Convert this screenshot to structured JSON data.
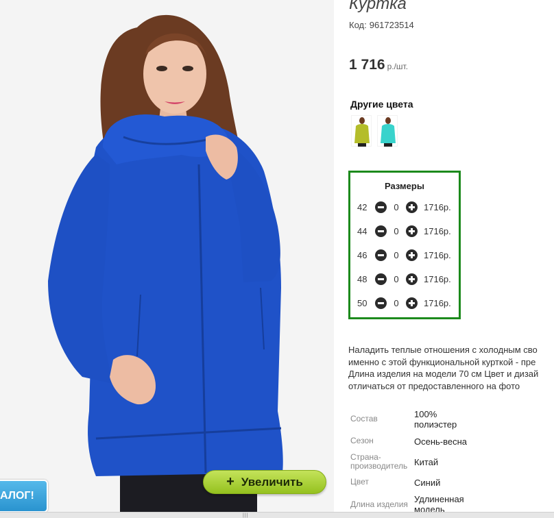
{
  "product": {
    "title": "Куртка",
    "code_label": "Код:",
    "code_value": "961723514",
    "price": "1 716",
    "price_unit": "р./шт."
  },
  "other_colors": {
    "title": "Другие цвета",
    "items": [
      {
        "name": "yellow-green",
        "color": "#b4bd2a"
      },
      {
        "name": "turquoise",
        "color": "#39d3cc"
      }
    ]
  },
  "sizes": {
    "title": "Размеры",
    "rows": [
      {
        "size": "42",
        "qty": "0",
        "price": "1716р."
      },
      {
        "size": "44",
        "qty": "0",
        "price": "1716р."
      },
      {
        "size": "46",
        "qty": "0",
        "price": "1716р."
      },
      {
        "size": "48",
        "qty": "0",
        "price": "1716р."
      },
      {
        "size": "50",
        "qty": "0",
        "price": "1716р."
      }
    ]
  },
  "description": [
    "Наладить теплые отношения с холодным сво",
    "именно с этой функциональной курткой - пре",
    "Длина изделия на модели 70 см Цвет и дизай",
    "отличаться от предоставленного на фото"
  ],
  "specs": [
    {
      "label": "Состав",
      "value": "100% полиэстер"
    },
    {
      "label": "Сезон",
      "value": "Осень-весна"
    },
    {
      "label": "Страна-производитель",
      "value": "Китай"
    },
    {
      "label": "Цвет",
      "value": "Синий"
    },
    {
      "label": "Длина изделия",
      "value": "Удлиненная модель"
    }
  ],
  "zoom_button": {
    "icon": "+",
    "label": "Увеличить"
  },
  "catalog_tab": {
    "label": "АЛОГ!"
  },
  "colors": {
    "sizes_border": "#1c8a1c",
    "zoom_button": "#a8cf2e",
    "jacket": "#1f52c8",
    "catalog_tab": "#3aa6dd"
  }
}
